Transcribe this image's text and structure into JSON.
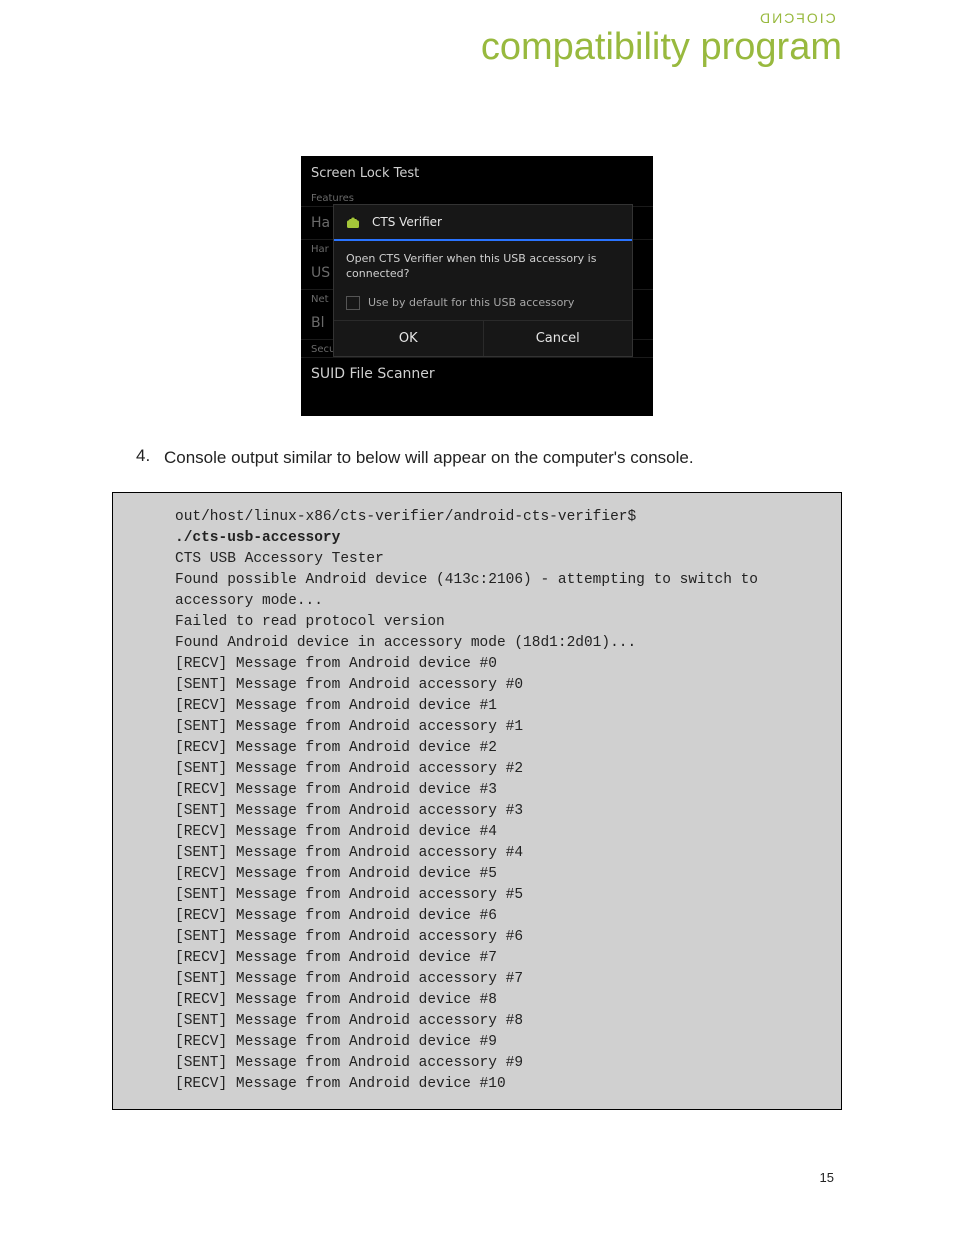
{
  "header": {
    "brand_small": "CIOFCND",
    "brand_big": "compatibility program"
  },
  "phone": {
    "title": "Screen Lock Test",
    "section_features": "Features",
    "row_ha": "Ha",
    "row_har": "Har",
    "row_us": "US",
    "row_net": "Net",
    "row_bl": "Bl",
    "section_security": "Security",
    "row_suid": "SUID File Scanner",
    "dialog": {
      "title": "CTS Verifier",
      "body": "Open CTS Verifier when this USB accessory is connected?",
      "checkbox": "Use by default for this USB accessory",
      "ok": "OK",
      "cancel": "Cancel"
    }
  },
  "step": {
    "number": "4.",
    "text": "Console output similar to below will appear on the computer's console."
  },
  "console": {
    "line1": "out/host/linux-x86/cts-verifier/android-cts-verifier$ ",
    "cmd": "./cts-usb-accessory",
    "rest": "CTS USB Accessory Tester\nFound possible Android device (413c:2106) - attempting to switch to\naccessory mode...\nFailed to read protocol version\nFound Android device in accessory mode (18d1:2d01)...\n[RECV] Message from Android device #0\n[SENT] Message from Android accessory #0\n[RECV] Message from Android device #1\n[SENT] Message from Android accessory #1\n[RECV] Message from Android device #2\n[SENT] Message from Android accessory #2\n[RECV] Message from Android device #3\n[SENT] Message from Android accessory #3\n[RECV] Message from Android device #4\n[SENT] Message from Android accessory #4\n[RECV] Message from Android device #5\n[SENT] Message from Android accessory #5\n[RECV] Message from Android device #6\n[SENT] Message from Android accessory #6\n[RECV] Message from Android device #7\n[SENT] Message from Android accessory #7\n[RECV] Message from Android device #8\n[SENT] Message from Android accessory #8\n[RECV] Message from Android device #9\n[SENT] Message from Android accessory #9\n[RECV] Message from Android device #10"
  },
  "page_number": "15"
}
